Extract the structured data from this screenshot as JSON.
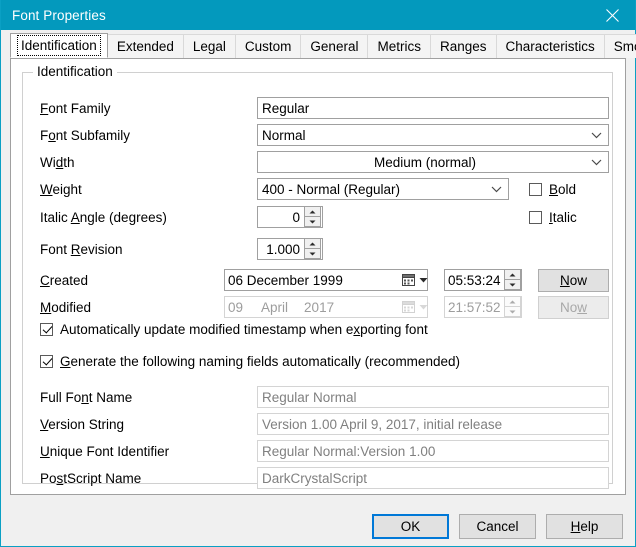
{
  "window": {
    "title": "Font Properties",
    "close_icon": "close-icon",
    "accent_color": "#0399bd"
  },
  "tabs": [
    {
      "label": "Identification",
      "selected": true
    },
    {
      "label": "Extended",
      "selected": false
    },
    {
      "label": "Legal",
      "selected": false
    },
    {
      "label": "Custom",
      "selected": false
    },
    {
      "label": "General",
      "selected": false
    },
    {
      "label": "Metrics",
      "selected": false
    },
    {
      "label": "Ranges",
      "selected": false
    },
    {
      "label": "Characteristics",
      "selected": false
    },
    {
      "label": "Smoothing",
      "selected": false
    }
  ],
  "group": {
    "legend": "Identification"
  },
  "fields": {
    "font_family": {
      "label_pre": "",
      "label_key": "F",
      "label_post": "ont Family",
      "value": "Regular"
    },
    "font_subfamily": {
      "label_pre": "F",
      "label_key": "o",
      "label_post": "nt Subfamily",
      "value": "Normal"
    },
    "width": {
      "label_pre": "Wi",
      "label_key": "d",
      "label_post": "th",
      "value": "Medium (normal)"
    },
    "weight": {
      "label_pre": "",
      "label_key": "W",
      "label_post": "eight",
      "value": "400 - Normal (Regular)"
    },
    "italic_angle": {
      "label_pre": "Italic ",
      "label_key": "A",
      "label_post": "ngle (degrees)",
      "value": "0"
    },
    "font_revision": {
      "label_pre": "Font ",
      "label_key": "R",
      "label_post": "evision",
      "value": "1.000"
    },
    "created": {
      "label_pre": "",
      "label_key": "C",
      "label_post": "reated",
      "date": "06 December 1999",
      "time": "05:53:24",
      "now_pre": "",
      "now_key": "N",
      "now_post": "ow"
    },
    "modified": {
      "label_pre": "",
      "label_key": "M",
      "label_post": "odified",
      "date_day": "09",
      "date_month": "April",
      "date_year": "2017",
      "time": "21:57:52",
      "now_pre": "No",
      "now_key": "w",
      "now_post": ""
    },
    "full_font_name": {
      "label_pre": "Full Fo",
      "label_key": "n",
      "label_post": "t Name",
      "value": "Regular Normal"
    },
    "version_string": {
      "label_pre": "",
      "label_key": "V",
      "label_post": "ersion String",
      "value": "Version 1.00 April 9, 2017, initial release"
    },
    "unique_font_identifier": {
      "label_pre": "",
      "label_key": "U",
      "label_post": "nique Font Identifier",
      "value": "Regular Normal:Version 1.00"
    },
    "postscript_name": {
      "label_pre": "Po",
      "label_key": "s",
      "label_post": "tScript Name",
      "value": "DarkCrystalScript"
    }
  },
  "checkboxes": {
    "bold": {
      "label_pre": "",
      "label_key": "B",
      "label_post": "old",
      "checked": false
    },
    "italic": {
      "label_pre": "",
      "label_key": "I",
      "label_post": "talic",
      "checked": false
    },
    "auto_update_modified": {
      "label_pre": "Automatically update modified timestamp when e",
      "label_key": "x",
      "label_post": "porting font",
      "checked": true
    },
    "generate_naming": {
      "label_pre": "",
      "label_key": "G",
      "label_post": "enerate the following naming fields automatically (recommended)",
      "checked": true
    }
  },
  "buttons": {
    "ok": {
      "pre": "OK",
      "key": "",
      "post": "",
      "default": true
    },
    "cancel": {
      "pre": "Cancel",
      "key": "",
      "post": ""
    },
    "help": {
      "pre": "",
      "key": "H",
      "post": "elp"
    }
  }
}
